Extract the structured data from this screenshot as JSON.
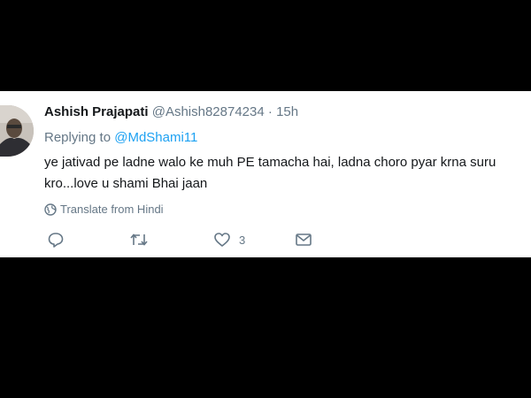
{
  "tweet": {
    "author_name": "Ashish Prajapati",
    "handle": "@Ashish82874234",
    "separator": "·",
    "time": "15h",
    "replying_label": "Replying to",
    "reply_mention": "@MdShami11",
    "text": "ye jativad pe ladne walo ke muh PE tamacha hai, ladna choro pyar krna suru kro...love u shami Bhai jaan",
    "translate_label": "Translate from Hindi",
    "like_count": "3"
  },
  "icons": {
    "avatar": "avatar",
    "translate": "globe-icon",
    "reply": "reply-icon",
    "retweet": "retweet-icon",
    "like": "heart-icon",
    "message": "envelope-icon"
  },
  "colors": {
    "background": "#000000",
    "card": "#ffffff",
    "text": "#14171a",
    "secondary": "#657786",
    "link": "#1da1f2"
  }
}
